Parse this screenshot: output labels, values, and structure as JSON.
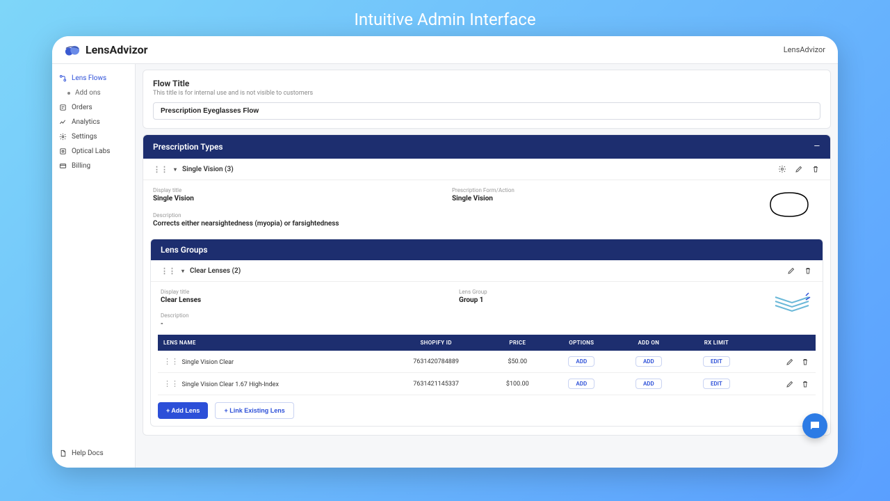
{
  "frame_title": "Intuitive Admin Interface",
  "brand": {
    "name": "LensAdvizor"
  },
  "account_label": "LensAdvizor",
  "sidebar": {
    "items": [
      {
        "label": "Lens Flows",
        "active": true
      },
      {
        "label": "Add ons",
        "sub": true
      },
      {
        "label": "Orders"
      },
      {
        "label": "Analytics"
      },
      {
        "label": "Settings"
      },
      {
        "label": "Optical Labs"
      },
      {
        "label": "Billing"
      }
    ],
    "help": "Help Docs"
  },
  "flow": {
    "title_label": "Flow Title",
    "subtitle": "This title is for internal use and is not visible to customers",
    "value": "Prescription Eyeglasses Flow"
  },
  "prescription_types": {
    "header": "Prescription Types",
    "row_title": "Single Vision (3)",
    "display_title_label": "Display title",
    "display_title_value": "Single Vision",
    "form_label": "Prescription Form/Action",
    "form_value": "Single Vision",
    "desc_label": "Description",
    "desc_value": "Corrects either nearsightedness (myopia) or farsightedness"
  },
  "lens_groups": {
    "header": "Lens Groups",
    "row_title": "Clear Lenses (2)",
    "display_title_label": "Display title",
    "display_title_value": "Clear Lenses",
    "group_label": "Lens Group",
    "group_value": "Group 1",
    "desc_label": "Description",
    "desc_value": "-"
  },
  "lens_table": {
    "columns": [
      "LENS NAME",
      "SHOPIFY ID",
      "PRICE",
      "OPTIONS",
      "ADD ON",
      "RX LIMIT",
      ""
    ],
    "rows": [
      {
        "name": "Single Vision Clear",
        "shopify_id": "7631420784889",
        "price": "$50.00",
        "options": "ADD",
        "addon": "ADD",
        "rxlimit": "EDIT"
      },
      {
        "name": "Single Vision Clear 1.67 High-Index",
        "shopify_id": "7631421145337",
        "price": "$100.00",
        "options": "ADD",
        "addon": "ADD",
        "rxlimit": "EDIT"
      }
    ]
  },
  "buttons": {
    "add_lens": "+ Add Lens",
    "link_existing": "+ Link Existing Lens"
  }
}
